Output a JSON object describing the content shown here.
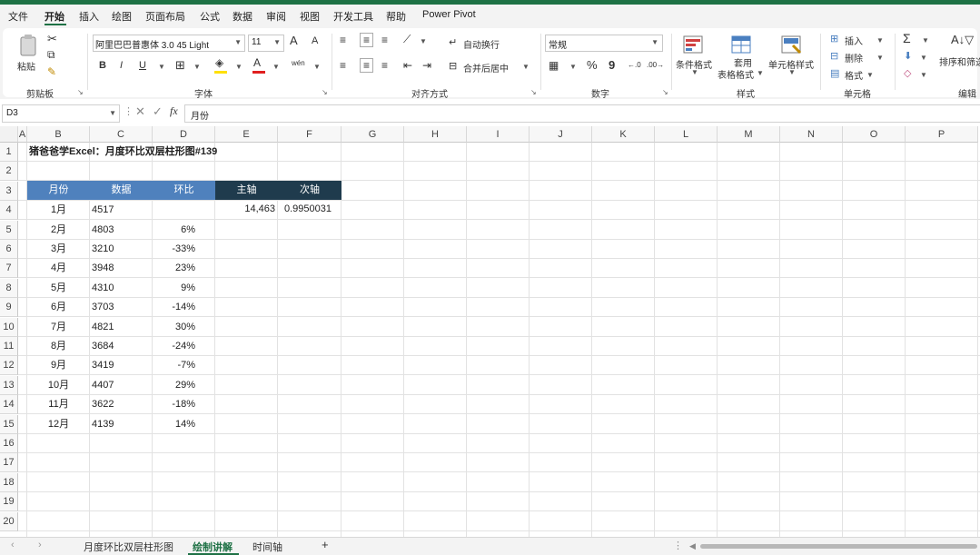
{
  "menu": {
    "items": [
      "文件",
      "开始",
      "插入",
      "绘图",
      "页面布局",
      "公式",
      "数据",
      "审阅",
      "视图",
      "开发工具",
      "帮助",
      "Power Pivot"
    ],
    "active": "开始"
  },
  "ribbon": {
    "clipboard": {
      "paste": "粘贴",
      "label": "剪贴板"
    },
    "font": {
      "name": "阿里巴巴普惠体 3.0 45 Light",
      "size": "11",
      "bold": "B",
      "italic": "I",
      "underline": "U",
      "label": "字体",
      "grow": "A",
      "shrink": "A",
      "font_color": "A",
      "phonetic": "wén"
    },
    "alignment": {
      "wrap": "自动换行",
      "merge": "合并后居中",
      "label": "对齐方式"
    },
    "number": {
      "format": "常规",
      "percent": "%",
      "comma": "9",
      "label": "数字"
    },
    "styles": {
      "conditional": "条件格式",
      "table_line1": "套用",
      "table_line2": "表格格式",
      "cell_styles": "单元格样式",
      "label": "样式"
    },
    "cells": {
      "insert": "插入",
      "delete": "删除",
      "format": "格式",
      "label": "单元格"
    },
    "editing": {
      "sort_filter": "排序和筛选",
      "sum": "Σ",
      "label": "编辑"
    }
  },
  "formula_bar": {
    "name_box": "D3",
    "fx": "fx",
    "content": "月份"
  },
  "columns": [
    "A",
    "B",
    "C",
    "D",
    "E",
    "F",
    "G",
    "H",
    "I",
    "J",
    "K",
    "L",
    "M",
    "N",
    "O",
    "P"
  ],
  "rows": [
    "1",
    "2",
    "3",
    "4",
    "5",
    "6",
    "7",
    "8",
    "9",
    "10",
    "11",
    "12",
    "13",
    "14",
    "15",
    "16",
    "17",
    "18",
    "19",
    "20"
  ],
  "sheet": {
    "title": "猪爸爸学Excel：月度环比双层柱形图#139",
    "headers": [
      "月份",
      "数据",
      "环比"
    ],
    "axis_headers": [
      "主轴",
      "次轴"
    ],
    "axis_values": [
      "14,463",
      "0.9950031"
    ],
    "table": [
      {
        "month": "1月",
        "value": "4517",
        "ratio": ""
      },
      {
        "month": "2月",
        "value": "4803",
        "ratio": "6%"
      },
      {
        "month": "3月",
        "value": "3210",
        "ratio": "-33%"
      },
      {
        "month": "4月",
        "value": "3948",
        "ratio": "23%"
      },
      {
        "month": "5月",
        "value": "4310",
        "ratio": "9%"
      },
      {
        "month": "6月",
        "value": "3703",
        "ratio": "-14%"
      },
      {
        "month": "7月",
        "value": "4821",
        "ratio": "30%"
      },
      {
        "month": "8月",
        "value": "3684",
        "ratio": "-24%"
      },
      {
        "month": "9月",
        "value": "3419",
        "ratio": "-7%"
      },
      {
        "month": "10月",
        "value": "4407",
        "ratio": "29%"
      },
      {
        "month": "11月",
        "value": "3622",
        "ratio": "-18%"
      },
      {
        "month": "12月",
        "value": "4139",
        "ratio": "14%"
      }
    ],
    "colors": {
      "header_blue": "#4f81bd",
      "header_dark": "#1f3b4d",
      "brand_green": "#1e7145"
    }
  },
  "tabs": {
    "items": [
      "月度环比双层柱形图",
      "绘制讲解",
      "时间轴"
    ],
    "active": "绘制讲解",
    "add": "+"
  }
}
